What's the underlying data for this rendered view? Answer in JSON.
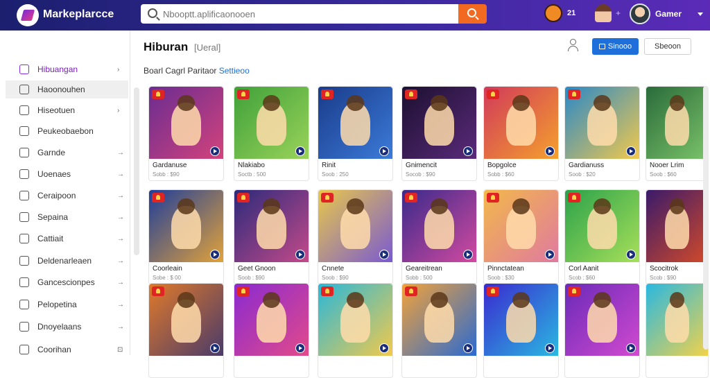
{
  "header": {
    "brand": "Markeplarcce",
    "search_placeholder": "Nbooptt.aplificaonooen",
    "notification_count": "21",
    "plus": "+",
    "username": "Gamer"
  },
  "sidebar": {
    "items": [
      {
        "label": "Hibuangan",
        "chevron": "›",
        "active": true
      },
      {
        "label": "Haoonouhen",
        "chevron": ""
      },
      {
        "label": "Hiseotuen",
        "chevron": "›"
      },
      {
        "label": "Peukeobaebon",
        "chevron": ""
      },
      {
        "label": "Garnde",
        "chevron": "→"
      },
      {
        "label": "Uoenaes",
        "chevron": "→"
      },
      {
        "label": "Ceraipoon",
        "chevron": "→"
      },
      {
        "label": "Sepaina",
        "chevron": "→"
      },
      {
        "label": "Cattiait",
        "chevron": "→"
      },
      {
        "label": "Deldenarleaen",
        "chevron": "→"
      },
      {
        "label": "Gancescionpes",
        "chevron": "→"
      },
      {
        "label": "Pelopetina",
        "chevron": "→"
      },
      {
        "label": "Dnoyelaans",
        "chevron": "→"
      },
      {
        "label": "Coorihan",
        "chevron": "⊡"
      }
    ]
  },
  "main": {
    "title": "Hiburan",
    "subtitle": "[Ueral]",
    "primary_button": "Sinooo",
    "secondary_button": "Sbeoon",
    "sort_label": "Boarl Cagrl Paritaor",
    "sort_link": "Settieoo",
    "cards": [
      {
        "name": "Gardanuse",
        "price": "Sobb : $90",
        "colors": [
          "#6a2c91",
          "#d3437c"
        ]
      },
      {
        "name": "Nlakiabo",
        "price": "Soctb : 500",
        "colors": [
          "#3fa13a",
          "#9ad35a"
        ]
      },
      {
        "name": "Rinit",
        "price": "Soob : 250",
        "colors": [
          "#1a3b8a",
          "#3b7bd9"
        ]
      },
      {
        "name": "Gnimencit",
        "price": "Socob : $90",
        "colors": [
          "#1c1030",
          "#5a2a7a"
        ]
      },
      {
        "name": "Bopgolce",
        "price": "Sobb : $60",
        "colors": [
          "#d13a5a",
          "#f4a02e"
        ]
      },
      {
        "name": "Gardianuss",
        "price": "Soob : $20",
        "colors": [
          "#2a88c8",
          "#f2c94c"
        ]
      },
      {
        "name": "Nooer Lrim",
        "price": "Soob : $60",
        "colors": [
          "#2a6b3a",
          "#7bc36a"
        ]
      },
      {
        "name": "Coorleain",
        "price": "Sobe : $ 00",
        "colors": [
          "#1f3e9a",
          "#e2a23a"
        ]
      },
      {
        "name": "Geet Gnoon",
        "price": "Soob : $90",
        "colors": [
          "#2b2a7a",
          "#c44a8a"
        ]
      },
      {
        "name": "Cnnete",
        "price": "Soob : $90",
        "colors": [
          "#e8c84a",
          "#7a5ad0"
        ]
      },
      {
        "name": "Geareitrean",
        "price": "Sobb : 500",
        "colors": [
          "#3a2a8a",
          "#d24aa0"
        ]
      },
      {
        "name": "Pinnctatean",
        "price": "Soob : $30",
        "colors": [
          "#f2b84a",
          "#e07aa0"
        ]
      },
      {
        "name": "Corl Aanit",
        "price": "Scob : $60",
        "colors": [
          "#2aa24a",
          "#a8e05a"
        ]
      },
      {
        "name": "Scocitrok",
        "price": "Scob : $90",
        "colors": [
          "#3a1a6a",
          "#d24a2a"
        ]
      },
      {
        "name": "",
        "price": "",
        "colors": [
          "#e07a2a",
          "#4a3a6a"
        ]
      },
      {
        "name": "",
        "price": "",
        "colors": [
          "#8a2ad0",
          "#e24a8a"
        ]
      },
      {
        "name": "",
        "price": "",
        "colors": [
          "#2ab8d8",
          "#f2c94c"
        ]
      },
      {
        "name": "",
        "price": "",
        "colors": [
          "#f2a23a",
          "#2a6ad0"
        ]
      },
      {
        "name": "",
        "price": "",
        "colors": [
          "#3a2ad0",
          "#2ab8e0"
        ]
      },
      {
        "name": "",
        "price": "",
        "colors": [
          "#6a2ab8",
          "#d24ad0"
        ]
      },
      {
        "name": "",
        "price": "",
        "colors": [
          "#2ab8e0",
          "#f2d24a"
        ]
      }
    ]
  }
}
